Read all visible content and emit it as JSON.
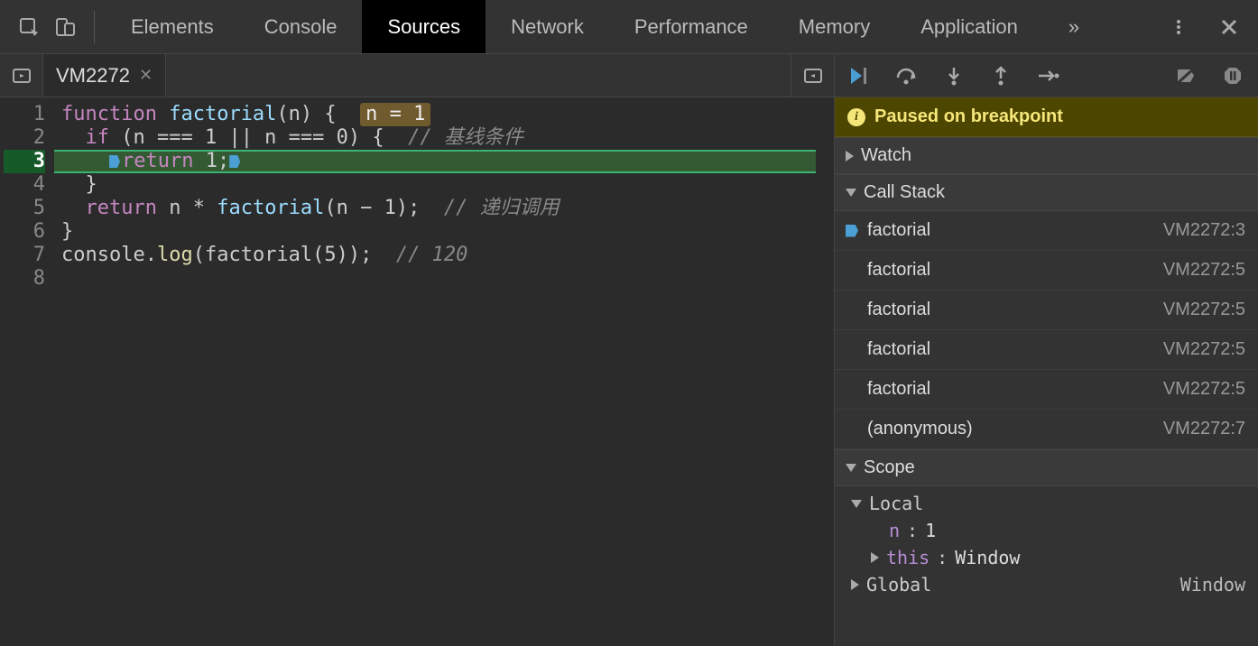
{
  "tabs": [
    "Elements",
    "Console",
    "Sources",
    "Network",
    "Performance",
    "Memory",
    "Application"
  ],
  "activeTab": "Sources",
  "moreGlyph": "»",
  "fileTab": {
    "name": "VM2272"
  },
  "gutterLines": [
    "1",
    "2",
    "3",
    "4",
    "5",
    "6",
    "7",
    "8"
  ],
  "breakpointLine": 3,
  "code": {
    "l1": {
      "kw": "function",
      "space": " ",
      "fn": "factorial",
      "rest": "(n) {  ",
      "hl": "n = 1"
    },
    "l2": {
      "indent": "  ",
      "kw": "if",
      "rest": " (n === 1 || n === 0) {  ",
      "cm": "// 基线条件"
    },
    "l3": {
      "indent": "    ",
      "kw": "return",
      "rest": " 1;"
    },
    "l4": {
      "indent": "  ",
      "brace": "}"
    },
    "l5": {
      "indent": "  ",
      "kw": "return",
      "rest": " n * ",
      "fn": "factorial",
      "rest2": "(n − 1);  ",
      "cm": "// 递归调用"
    },
    "l6": {
      "brace": "}"
    },
    "l7": {
      "obj": "console",
      "dot": ".",
      "fn": "log",
      "rest": "(factorial(5));  ",
      "cm": "// 120"
    }
  },
  "pauseMessage": "Paused on breakpoint",
  "sections": {
    "watch": "Watch",
    "callstack": "Call Stack",
    "scope": "Scope"
  },
  "callstack": [
    {
      "name": "factorial",
      "loc": "VM2272:3",
      "current": true
    },
    {
      "name": "factorial",
      "loc": "VM2272:5",
      "current": false
    },
    {
      "name": "factorial",
      "loc": "VM2272:5",
      "current": false
    },
    {
      "name": "factorial",
      "loc": "VM2272:5",
      "current": false
    },
    {
      "name": "factorial",
      "loc": "VM2272:5",
      "current": false
    },
    {
      "name": "(anonymous)",
      "loc": "VM2272:7",
      "current": false
    }
  ],
  "scope": {
    "localLabel": "Local",
    "nKey": "n",
    "nColon": ": ",
    "nVal": "1",
    "thisKey": "this",
    "thisColon": ": ",
    "thisVal": "Window",
    "globalLabel": "Global",
    "globalVal": "Window"
  }
}
